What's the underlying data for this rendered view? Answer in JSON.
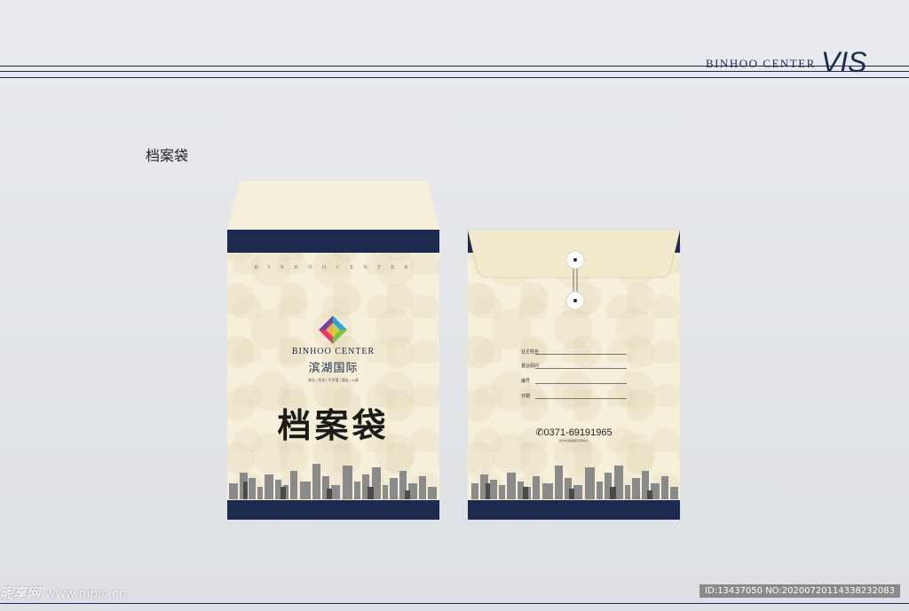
{
  "header": {
    "brand": "BINHOO CENTER",
    "vis": "VIS"
  },
  "section_title": "档案袋",
  "front": {
    "spaced_text": "B I N H O O C E N T E R",
    "logo_en": "BINHOO CENTER",
    "logo_cn": "滨湖国际",
    "logo_tagline": "商业 | 住宅 | 写字楼 | 酒店 | 公寓",
    "title": "档案袋"
  },
  "back": {
    "fields": [
      "业主姓名",
      "置业顾问",
      "编号",
      "日期"
    ],
    "phone": "✆0371-69191965",
    "address": "郑州市滨湖国际营销中心"
  },
  "watermark": {
    "left_logo": "昵享网",
    "left_url": "www.nipic.cn",
    "right_id": "ID:13437050 NO:20200720114338232083"
  },
  "colors": {
    "navy": "#1c2a4f",
    "paper": "#f6efd9"
  }
}
